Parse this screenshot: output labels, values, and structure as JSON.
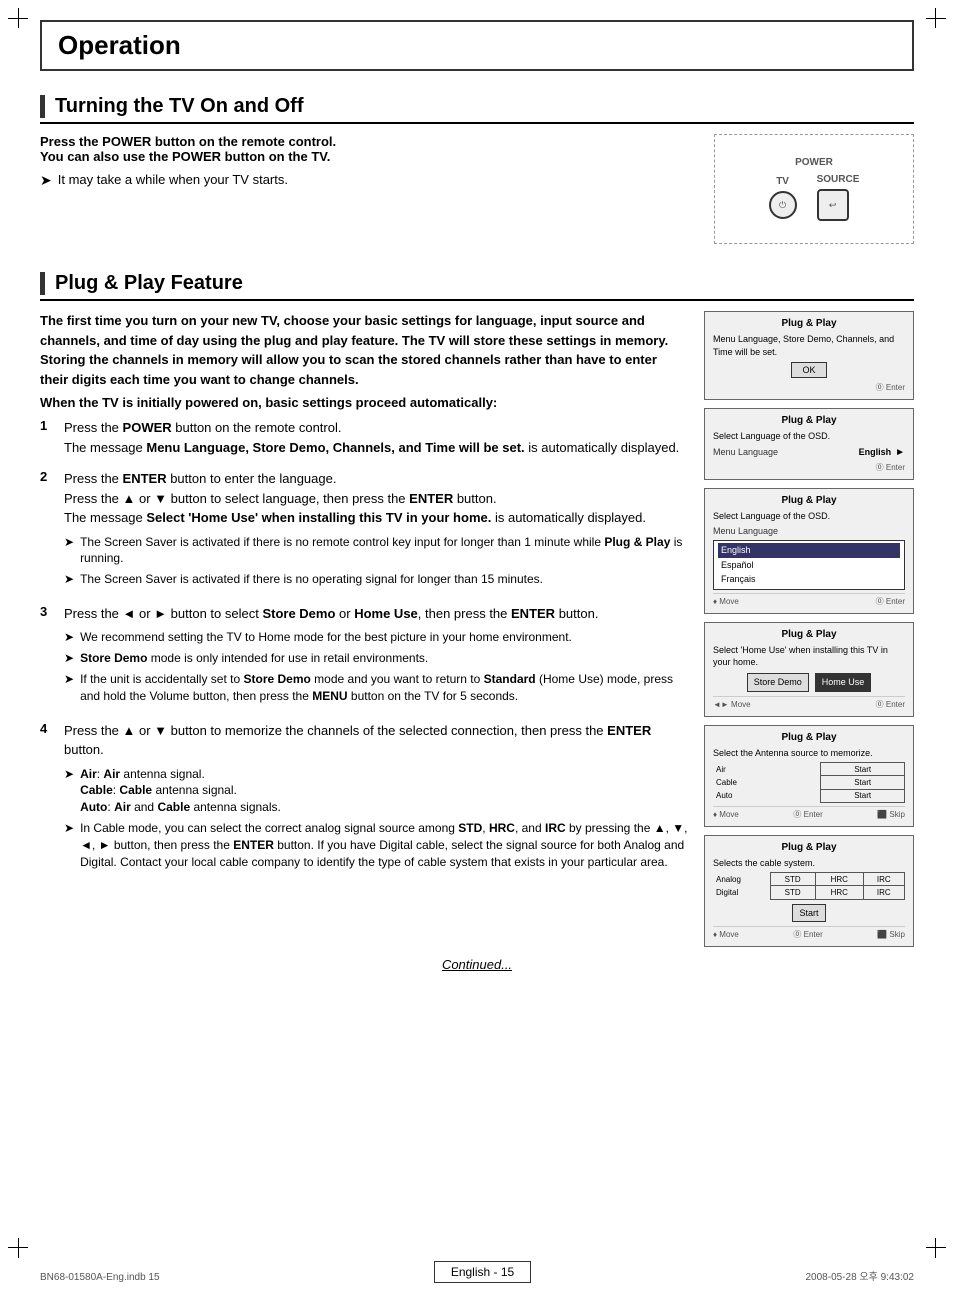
{
  "page": {
    "title": "Operation"
  },
  "section1": {
    "title": "Turning the TV On and Off",
    "bold_line1": "Press the POWER button on the remote control.",
    "bold_line2": "You can also use the POWER button on the TV.",
    "note": "It may take a while when your TV starts.",
    "tv_buttons": {
      "power_label": "POWER",
      "tv_label": "TV",
      "source_label": "SOURCE"
    }
  },
  "section2": {
    "title": "Plug & Play Feature",
    "intro": "The first time you turn on your new TV, choose your basic settings for language, input source and channels, and time of day using the plug and play feature. The TV will store these settings in memory. Storing the channels in memory will allow you to scan the stored channels rather than have to enter their digits each time you want to change channels.",
    "intro2": "When the TV is initially powered on, basic settings proceed automatically:",
    "steps": [
      {
        "number": "1",
        "text": "Press the POWER button on the remote control.",
        "text2": "The message Menu Language, Store Demo, Channels, and Time will be set. is automatically displayed.",
        "notes": []
      },
      {
        "number": "2",
        "text": "Press the ENTER button to enter the language.",
        "text2": "Press the ▲ or ▼ button to select language, then press the ENTER button.",
        "text3": "The message Select 'Home Use' when installing this TV in your home. is automatically displayed.",
        "notes": [
          "The Screen Saver is activated if there is no remote control key input for longer than 1 minute while Plug & Play is running.",
          "The Screen Saver is activated if there is no operating signal for longer than 15 minutes."
        ]
      },
      {
        "number": "3",
        "text": "Press the ◄ or ► button to select Store Demo or Home Use, then press the ENTER button.",
        "notes": [
          "We recommend setting the TV to Home mode for the best picture in your home environment.",
          "Store Demo mode is only intended for use in retail environments.",
          "If the unit is accidentally set to Store Demo mode and you want to return to Standard (Home Use) mode, press and hold the Volume button, then press the MENU button on the TV for 5 seconds."
        ]
      },
      {
        "number": "4",
        "text": "Press the ▲ or ▼ button to memorize the channels of the selected connection, then press the ENTER button.",
        "notes": [
          "Air: Air antenna signal.\nCable: Cable antenna signal.\nAuto: Air and Cable antenna signals.",
          "In Cable mode, you can select the correct analog signal source among STD, HRC, and IRC by pressing the ▲, ▼, ◄, ► button, then press the ENTER button. If you have Digital cable, select the signal source for both Analog and Digital. Contact your local cable company to identify the type of cable system that exists in your particular area."
        ]
      }
    ],
    "screens": [
      {
        "title": "Plug & Play",
        "body": "Menu Language, Store Demo, Channels, and Time will be set.",
        "type": "ok_button",
        "ok_label": "OK",
        "enter_label": "⓪ Enter"
      },
      {
        "title": "Plug & Play",
        "subtitle": "Select Language of the OSD.",
        "row_label": "Menu Language",
        "row_value": "English",
        "type": "language_row",
        "enter_label": "⓪ Enter"
      },
      {
        "title": "Plug & Play",
        "subtitle": "Select Language of the OSD.",
        "row_label": "Menu Language",
        "type": "language_dropdown",
        "dropdown_items": [
          "English",
          "Español",
          "Français"
        ],
        "selected": "English",
        "move_label": "♦ Move",
        "enter_label": "⓪ Enter"
      },
      {
        "title": "Plug & Play",
        "subtitle": "Select 'Home Use' when installing this TV in your home.",
        "type": "home_use",
        "btn1": "Store Demo",
        "btn2": "Home Use",
        "move_label": "◄► Move",
        "enter_label": "⓪ Enter"
      },
      {
        "title": "Plug & Play",
        "subtitle": "Select the Antenna source to memorize.",
        "type": "antenna",
        "items": [
          {
            "label": "Air",
            "btn": "Start"
          },
          {
            "label": "Cable",
            "btn": "Start"
          },
          {
            "label": "Auto",
            "btn": "Start"
          }
        ],
        "move_label": "♦ Move",
        "enter_label": "⓪ Enter",
        "skip_label": "⬛ Skip"
      },
      {
        "title": "Plug & Play",
        "subtitle": "Selects the cable system.",
        "type": "cable_system",
        "rows": [
          {
            "label": "Analog",
            "cols": [
              "STD",
              "HRC",
              "IRC"
            ]
          },
          {
            "label": "Digital",
            "cols": [
              "STD",
              "HRC",
              "IRC"
            ]
          }
        ],
        "start_label": "Start",
        "move_label": "♦ Move",
        "enter_label": "⓪ Enter",
        "skip_label": "⬛ Skip"
      }
    ]
  },
  "footer": {
    "continued": "Continued...",
    "lang_box": "English - 15",
    "left_file": "BN68-01580A-Eng.indb   15",
    "right_file": "2008-05-28   오후 9:43:02"
  }
}
